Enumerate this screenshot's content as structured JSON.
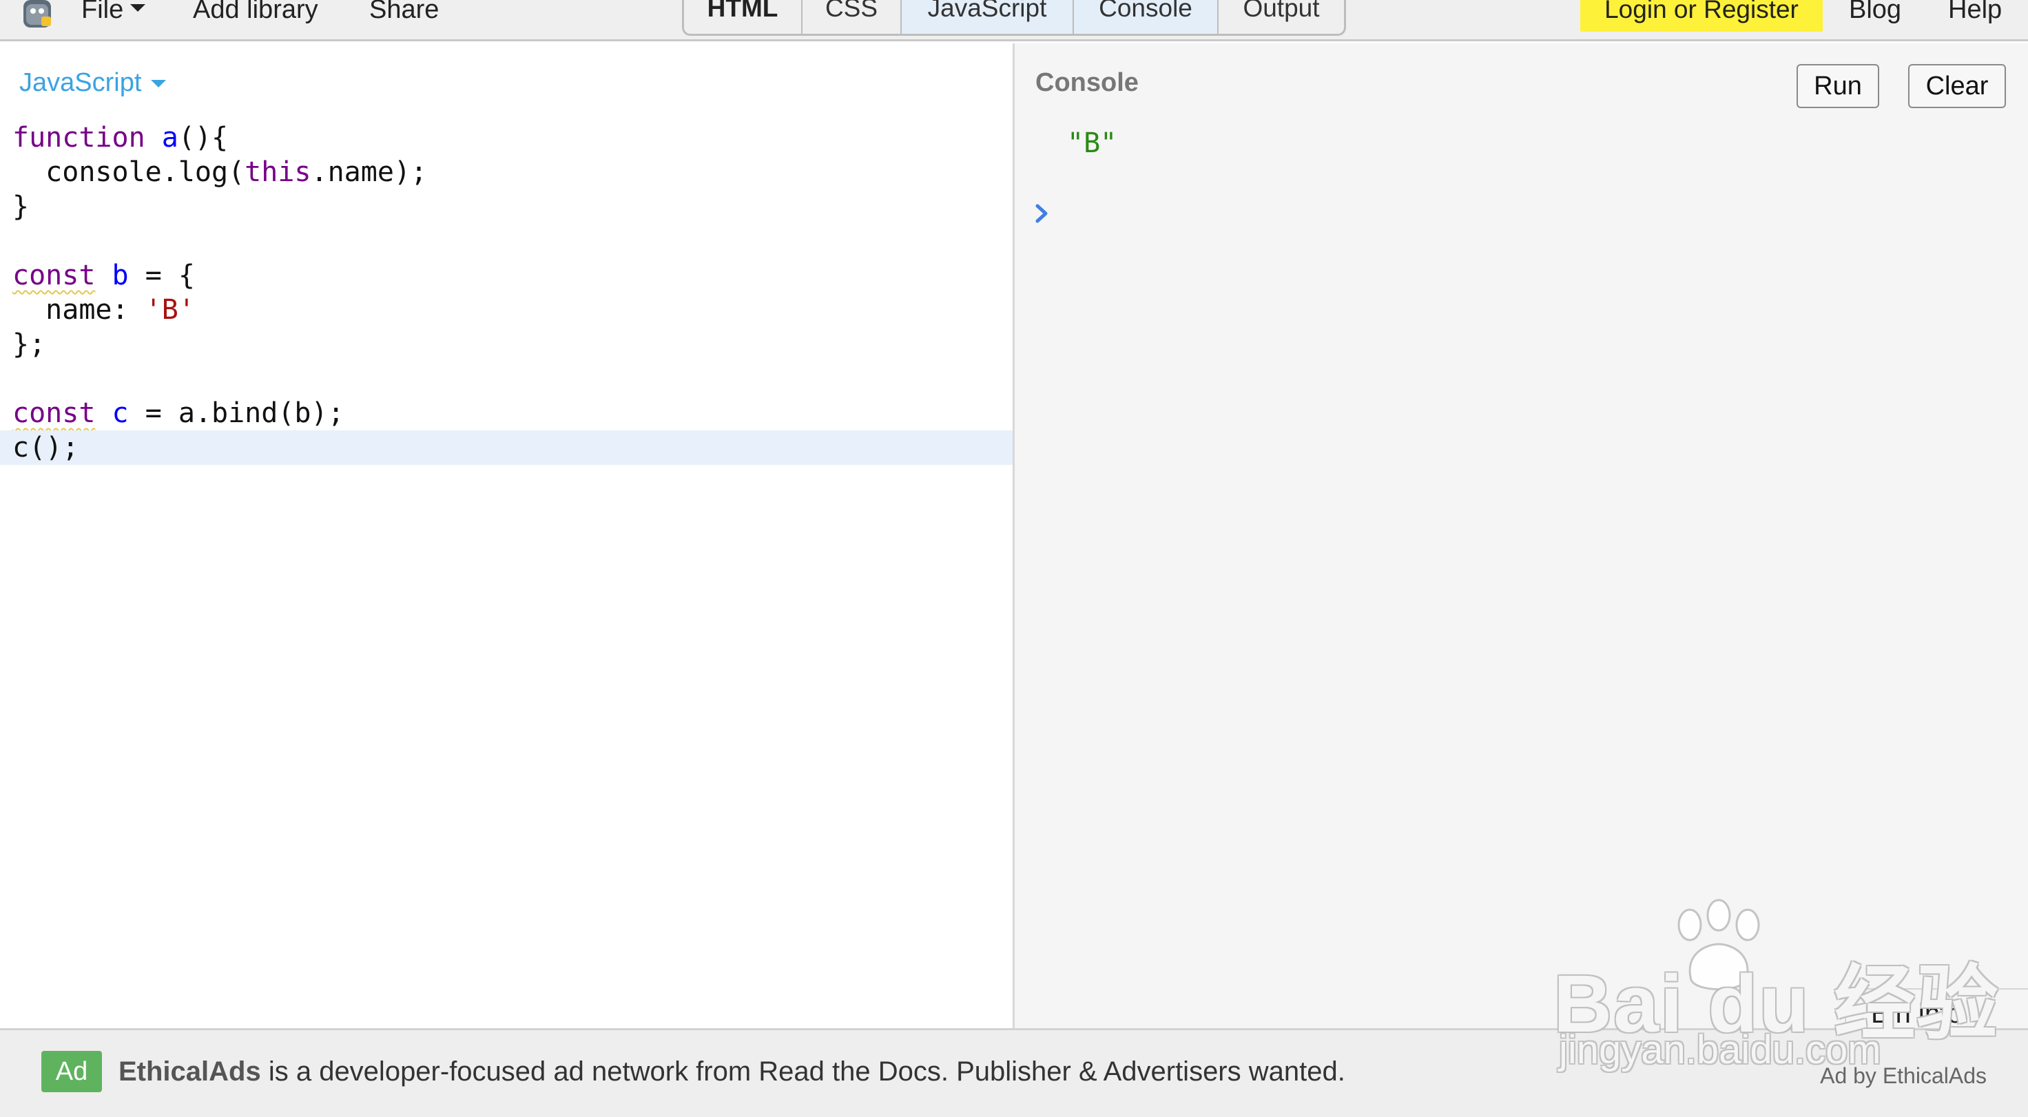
{
  "toolbar": {
    "file_label": "File",
    "add_library_label": "Add library",
    "share_label": "Share",
    "tabs": [
      {
        "label": "HTML",
        "active": false
      },
      {
        "label": "CSS",
        "active": false
      },
      {
        "label": "JavaScript",
        "active": true
      },
      {
        "label": "Console",
        "active": true
      },
      {
        "label": "Output",
        "active": false
      }
    ],
    "login_label": "Login or Register",
    "blog_label": "Blog",
    "help_label": "Help"
  },
  "editor": {
    "language_label": "JavaScript",
    "code_lines": [
      "function a(){",
      "  console.log(this.name);",
      "}",
      "",
      "const b = {",
      "  name: 'B'",
      "};",
      "",
      "const c = a.bind(b);",
      "c();"
    ]
  },
  "console": {
    "title": "Console",
    "run_label": "Run",
    "clear_label": "Clear",
    "output": "\"B\"",
    "bin_info_label": "Bin info"
  },
  "ad": {
    "badge": "Ad",
    "brand": "EthicalAds",
    "text": " is a developer-focused ad network from Read the Docs. Publisher & Advertisers wanted.",
    "by_label": "Ad by EthicalAds"
  },
  "watermark": {
    "main": "Bai du 经验",
    "sub": "jingyan.baidu.com"
  },
  "colors": {
    "accent_blue": "#3aa3e3",
    "login_yellow": "#fdf13a",
    "ad_green": "#5fb35f",
    "console_output_green": "#2a8a14",
    "keyword_purple": "#770088",
    "definition_blue": "#0000ff",
    "string_red": "#aa1111"
  }
}
